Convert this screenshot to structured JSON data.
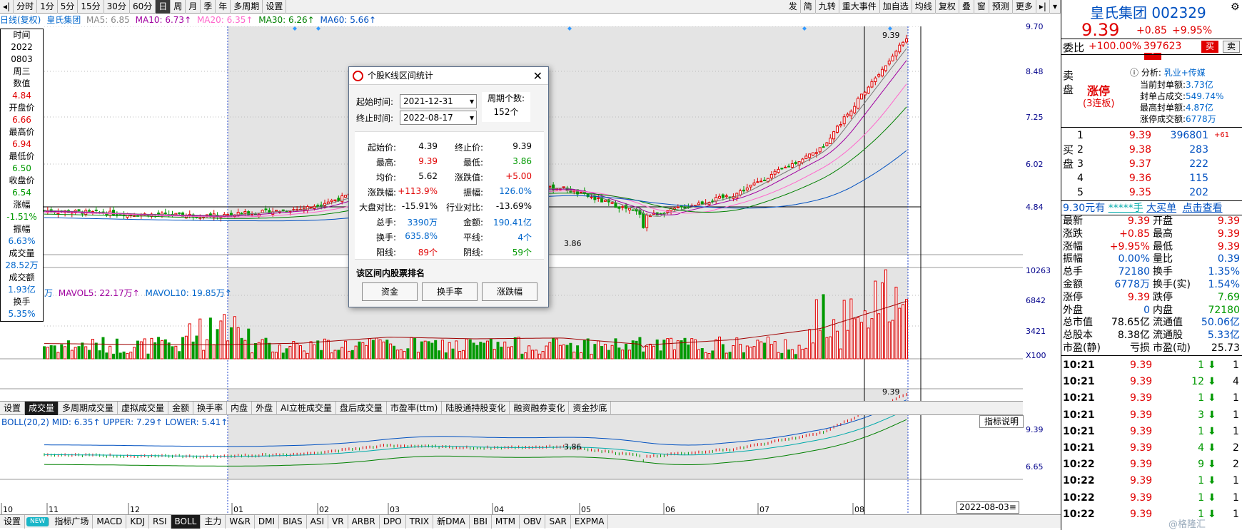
{
  "toolbar": {
    "left_items": [
      "分时",
      "1分",
      "5分",
      "15分",
      "30分",
      "60分",
      "日",
      "周",
      "月",
      "季",
      "年",
      "多周期",
      "设置"
    ],
    "active_index": 6,
    "right_items": [
      "发",
      "简",
      "九转",
      "重大事件",
      "加自选",
      "均线",
      "复权",
      "叠",
      "窗",
      "预测",
      "更多"
    ]
  },
  "infoline": {
    "period": "日线(复权)",
    "name": "皇氏集团",
    "ma5": "MA5: 6.85",
    "ma10": "MA10: 6.73↑",
    "ma20": "MA20: 6.35↑",
    "ma30": "MA30: 6.26↑",
    "ma60": "MA60: 5.66↑"
  },
  "sideinfo": [
    {
      "k": "时间",
      "v": "2022"
    },
    {
      "k": "",
      "v": "0803"
    },
    {
      "k": "",
      "v": "周三"
    },
    {
      "k": "数值",
      "v": "4.84"
    },
    {
      "k": "开盘价",
      "v": "6.66"
    },
    {
      "k": "最高价",
      "v": "6.94"
    },
    {
      "k": "最低价",
      "v": "6.50"
    },
    {
      "k": "收盘价",
      "v": "6.54"
    },
    {
      "k": "涨幅",
      "v": "-1.51%"
    },
    {
      "k": "振幅",
      "v": "6.63%"
    },
    {
      "k": "成交量",
      "v": "28.52万"
    },
    {
      "k": "成交额",
      "v": "1.93亿"
    },
    {
      "k": "换手",
      "v": "5.35%"
    }
  ],
  "price_axis": [
    "9.70",
    "8.48",
    "7.25",
    "6.02",
    "4.84"
  ],
  "vol_axis": [
    "10263",
    "6842",
    "3421",
    "X100"
  ],
  "boll_axis": [
    "9.39",
    "6.65"
  ],
  "markers": {
    "high_label": "9.39",
    "low_label": "3.86",
    "boll_high": "9.39",
    "boll_low": "3.86"
  },
  "vol_line": {
    "unit": "万",
    "mavol5": "MAVOL5: 22.17万↑",
    "mavol10": "MAVOL10: 19.85万↑"
  },
  "boll_line": {
    "text": "BOLL(20,2) MID: 6.35↑ UPPER: 7.29↑ LOWER: 5.41↑",
    "help": "指标说明"
  },
  "x_axis": [
    "10",
    "11",
    "12",
    "01",
    "02",
    "03",
    "04",
    "05",
    "06",
    "07",
    "08"
  ],
  "crosshair_date": "2022-08-03",
  "indicator_tabs": [
    "设置",
    "成交量",
    "多周期成交量",
    "虚拟成交量",
    "金额",
    "换手率",
    "内盘",
    "外盘",
    "AI立桩成交量",
    "盘后成交量",
    "市盈率(ttm)",
    "陆股通持股变化",
    "融资融券变化",
    "资金抄底"
  ],
  "indicator_active": 1,
  "bottom_tabs": [
    "设置",
    "NEW",
    "指标广场",
    "MACD",
    "KDJ",
    "RSI",
    "BOLL",
    "主力",
    "W&R",
    "DMI",
    "BIAS",
    "ASI",
    "VR",
    "ARBR",
    "DPO",
    "TRIX",
    "新DMA",
    "BBI",
    "MTM",
    "OBV",
    "SAR",
    "EXPMA"
  ],
  "bottom_active": 6,
  "dialog": {
    "title": "个股K线区间统计",
    "start_label": "起始时间:",
    "start_value": "2021-12-31",
    "end_label": "终止时间:",
    "end_value": "2022-08-17",
    "period_label": "周期个数:",
    "period_value": "152个",
    "stats_left": [
      {
        "k": "起始价:",
        "v": "4.39"
      },
      {
        "k": "最高:",
        "v": "9.39"
      },
      {
        "k": "均价:",
        "v": "5.62"
      },
      {
        "k": "涨跌幅:",
        "v": "+113.9%"
      },
      {
        "k": "大盘对比:",
        "v": "-15.91%"
      },
      {
        "k": "总手:",
        "v": "3390万"
      },
      {
        "k": "换手:",
        "v": "635.8%"
      },
      {
        "k": "阳线:",
        "v": "89个"
      }
    ],
    "stats_right": [
      {
        "k": "终止价:",
        "v": "9.39"
      },
      {
        "k": "最低:",
        "v": "3.86"
      },
      {
        "k": "涨跌值:",
        "v": "+5.00"
      },
      {
        "k": "振幅:",
        "v": "126.0%"
      },
      {
        "k": "行业对比:",
        "v": "-13.69%"
      },
      {
        "k": "金额:",
        "v": "190.41亿"
      },
      {
        "k": "平线:",
        "v": "4个"
      },
      {
        "k": "阴线:",
        "v": "59个"
      }
    ],
    "rank_label": "该区间内股票排名",
    "buttons": [
      "资金",
      "换手率",
      "涨跌幅"
    ]
  },
  "panel": {
    "title": "皇氏集团 002329",
    "price": "9.39",
    "change": "+0.85",
    "change_pct": "+9.95%",
    "weibi_label": "委比",
    "weibi": "+100.00%",
    "weicha": "397623",
    "buy_btn": "买",
    "sell_btn": "卖",
    "sell_side_label": "卖盘",
    "limit_up": "涨停",
    "limit_sub": "(3连板)",
    "analysis_label": "分析:",
    "analysis_value": "乳业+传媒",
    "seal_rows": [
      {
        "k": "当前封单额:",
        "v": "3.73亿"
      },
      {
        "k": "封单占成交:",
        "v": "549.74%"
      },
      {
        "k": "最高封单额:",
        "v": "4.87亿"
      },
      {
        "k": "涨停成交额:",
        "v": "6778万"
      }
    ],
    "buy_side_label": "买盘",
    "bids": [
      {
        "lv": "1",
        "p": "9.39",
        "v": "396801",
        "d": "+61"
      },
      {
        "lv": "2",
        "p": "9.38",
        "v": "283",
        "d": ""
      },
      {
        "lv": "3",
        "p": "9.37",
        "v": "222",
        "d": ""
      },
      {
        "lv": "4",
        "p": "9.36",
        "v": "115",
        "d": ""
      },
      {
        "lv": "5",
        "p": "9.35",
        "v": "202",
        "d": ""
      }
    ],
    "big_order": {
      "price": "9.30元有",
      "qty": "*****手",
      "label": "大买单",
      "link": "点击查看"
    },
    "quotes": [
      {
        "k1": "最新",
        "v1": "9.39",
        "k2": "开盘",
        "v2": "9.39"
      },
      {
        "k1": "涨跌",
        "v1": "+0.85",
        "k2": "最高",
        "v2": "9.39"
      },
      {
        "k1": "涨幅",
        "v1": "+9.95%",
        "k2": "最低",
        "v2": "9.39"
      },
      {
        "k1": "振幅",
        "v1": "0.00%",
        "k2": "量比",
        "v2": "0.39"
      },
      {
        "k1": "总手",
        "v1": "72180",
        "k2": "换手",
        "v2": "1.35%"
      },
      {
        "k1": "金额",
        "v1": "6778万",
        "k2": "换手(实)",
        "v2": "1.54%"
      },
      {
        "k1": "涨停",
        "v1": "9.39",
        "k2": "跌停",
        "v2": "7.69"
      },
      {
        "k1": "外盘",
        "v1": "0",
        "k2": "内盘",
        "v2": "72180"
      },
      {
        "k1": "总市值",
        "v1": "78.65亿",
        "k2": "流通值",
        "v2": "50.06亿"
      },
      {
        "k1": "总股本",
        "v1": "8.38亿",
        "k2": "流通股",
        "v2": "5.33亿"
      },
      {
        "k1": "市盈(静)",
        "v1": "亏损",
        "k2": "市盈(动)",
        "v2": "25.73"
      }
    ],
    "ticks": [
      {
        "t": "10:21",
        "p": "9.39",
        "v": "1",
        "n": "1"
      },
      {
        "t": "10:21",
        "p": "9.39",
        "v": "12",
        "n": "4"
      },
      {
        "t": "10:21",
        "p": "9.39",
        "v": "1",
        "n": "1"
      },
      {
        "t": "10:21",
        "p": "9.39",
        "v": "3",
        "n": "1"
      },
      {
        "t": "10:21",
        "p": "9.39",
        "v": "1",
        "n": "1"
      },
      {
        "t": "10:21",
        "p": "9.39",
        "v": "4",
        "n": "2"
      },
      {
        "t": "10:22",
        "p": "9.39",
        "v": "9",
        "n": "2"
      },
      {
        "t": "10:22",
        "p": "9.39",
        "v": "1",
        "n": "1"
      },
      {
        "t": "10:22",
        "p": "9.39",
        "v": "1",
        "n": "1"
      },
      {
        "t": "10:22",
        "p": "9.39",
        "v": "1",
        "n": "1"
      }
    ],
    "watermark": "@格隆汇"
  },
  "chart_data": {
    "type": "candlestick",
    "note": "Daily K-line, approx. monthly summary of the visible series (Oct 2021 – Aug 2022)",
    "x": [
      "10",
      "11",
      "12",
      "01",
      "02",
      "03",
      "04",
      "05",
      "06",
      "07",
      "08"
    ],
    "close": [
      4.45,
      4.35,
      4.3,
      4.5,
      5.2,
      5.0,
      5.1,
      4.3,
      4.9,
      6.2,
      9.39
    ],
    "ylim": [
      3.6,
      9.7
    ],
    "max": 9.39,
    "min": 3.86
  }
}
